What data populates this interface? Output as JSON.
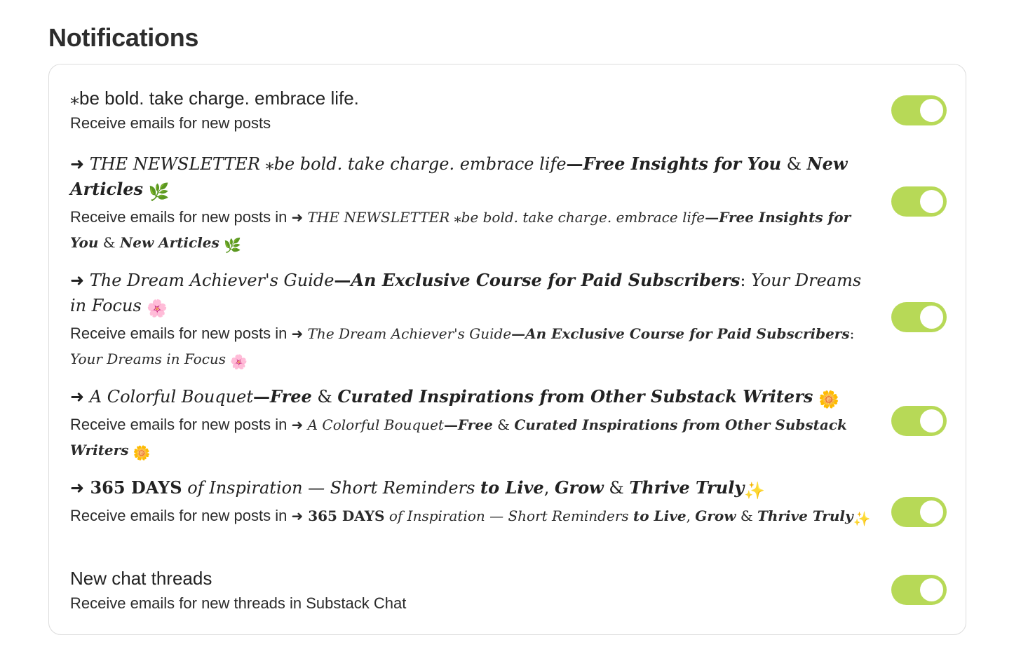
{
  "section_title": "Notifications",
  "colors": {
    "toggle_on": "#b7d957",
    "border": "#dcdcdc",
    "text": "#2b2b2b"
  },
  "rows": [
    {
      "title": "⁎be bold. take charge. embrace life.",
      "subtitle": "Receive emails for new posts",
      "enabled": true
    },
    {
      "title_parts": {
        "arrow": "➜",
        "pub_name": " THE NEWSLETTER ⁎be bold. take charge. embrace life",
        "dash": "—",
        "bold_a": "Free Insights for You",
        "amp": " & ",
        "bold_b": "New Articles",
        "emoji": "🌿"
      },
      "subtitle_prefix": "Receive emails for new posts in ",
      "enabled": true
    },
    {
      "title_parts": {
        "arrow": "➜",
        "pub_name": " The Dream Achiever's Guide",
        "dash": "—",
        "bold_a": "An Exclusive Course for Paid Subscribers",
        "colon": ":",
        "tail": " Your Dreams in Focus",
        "emoji": "🌸"
      },
      "subtitle_prefix": "Receive emails for new posts in ",
      "enabled": true
    },
    {
      "title_parts": {
        "arrow": "➜",
        "pub_name": " A Colorful Bouquet",
        "dash": "—",
        "bold_a": "Free",
        "amp": " & ",
        "bold_b": "Curated Inspirations from Other Substack Writers",
        "emoji": "🌼"
      },
      "subtitle_prefix": "Receive emails for new posts in ",
      "enabled": true
    },
    {
      "title_parts": {
        "arrow": "➜",
        "bold_a": " 365 DAYS",
        "of": " of",
        "pub_name": " Inspiration — Short Reminders ",
        "bold_b": "to Live",
        "comma": ", ",
        "bold_c": "Grow",
        "amp": " & ",
        "bold_d": "Thrive Truly",
        "emoji": "✨"
      },
      "subtitle_prefix": "Receive emails for new posts in ",
      "enabled": true
    },
    {
      "title": "New chat threads",
      "subtitle": "Receive emails for new threads in Substack Chat",
      "enabled": true
    }
  ]
}
